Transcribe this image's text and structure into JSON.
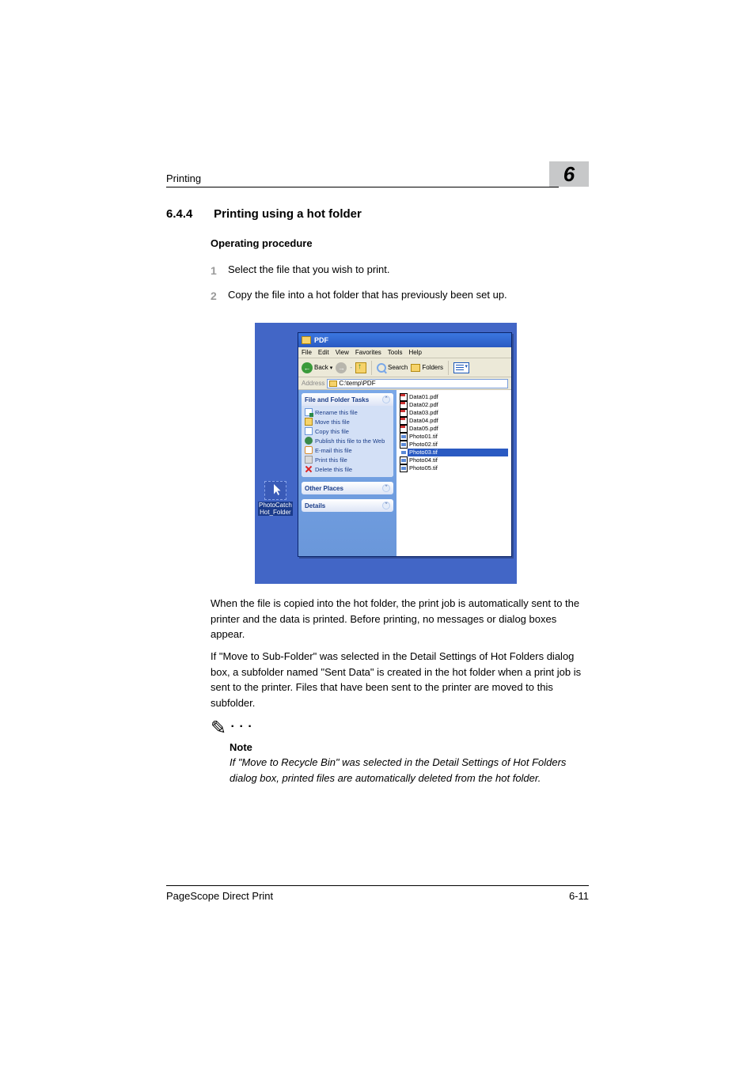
{
  "header": {
    "running": "Printing",
    "chapter": "6"
  },
  "section": {
    "number": "6.4.4",
    "title": "Printing using a hot folder"
  },
  "subhead": "Operating procedure",
  "steps": [
    {
      "n": "1",
      "text": "Select the file that you wish to print."
    },
    {
      "n": "2",
      "text": "Copy the file into a hot folder that has previously been set up."
    }
  ],
  "desktop": {
    "icon1_label": "PhotoCatch",
    "icon2_label": "Hot_Folder"
  },
  "explorer": {
    "title": "PDF",
    "menus": {
      "file": "File",
      "edit": "Edit",
      "view": "View",
      "favorites": "Favorites",
      "tools": "Tools",
      "help": "Help"
    },
    "toolbar": {
      "back": "Back",
      "search": "Search",
      "folders": "Folders"
    },
    "address": {
      "label": "Address",
      "path": "C:\\temp\\PDF"
    },
    "task_panel": {
      "title": "File and Folder Tasks",
      "items": {
        "rename": "Rename this file",
        "move": "Move this file",
        "copy": "Copy this file",
        "publish": "Publish this file to the Web",
        "email": "E-mail this file",
        "print": "Print this file",
        "delete": "Delete this file"
      }
    },
    "other_places": "Other Places",
    "details": "Details",
    "files": [
      "Data01.pdf",
      "Data02.pdf",
      "Data03.pdf",
      "Data04.pdf",
      "Data05.pdf",
      "Photo01.tif",
      "Photo02.tif",
      "Photo03.tif",
      "Photo04.tif",
      "Photo05.tif"
    ],
    "selected": "Photo03.tif"
  },
  "paragraphs": {
    "p1": "When the file is copied into the hot folder, the print job is automatically sent to the printer and the data is printed. Before printing, no messages or dialog boxes appear.",
    "p2": "If \"Move to Sub-Folder\" was selected in the Detail Settings of Hot Folders dialog box, a subfolder named \"Sent Data\" is created in the hot folder when a print job is sent to the printer. Files that have been sent to the printer are moved to this subfolder."
  },
  "note": {
    "label": "Note",
    "text": "If \"Move to Recycle Bin\" was selected in the Detail Settings of Hot Folders dialog box, printed files are automatically deleted from the hot folder."
  },
  "footer": {
    "left": "PageScope Direct Print",
    "right": "6-11"
  }
}
